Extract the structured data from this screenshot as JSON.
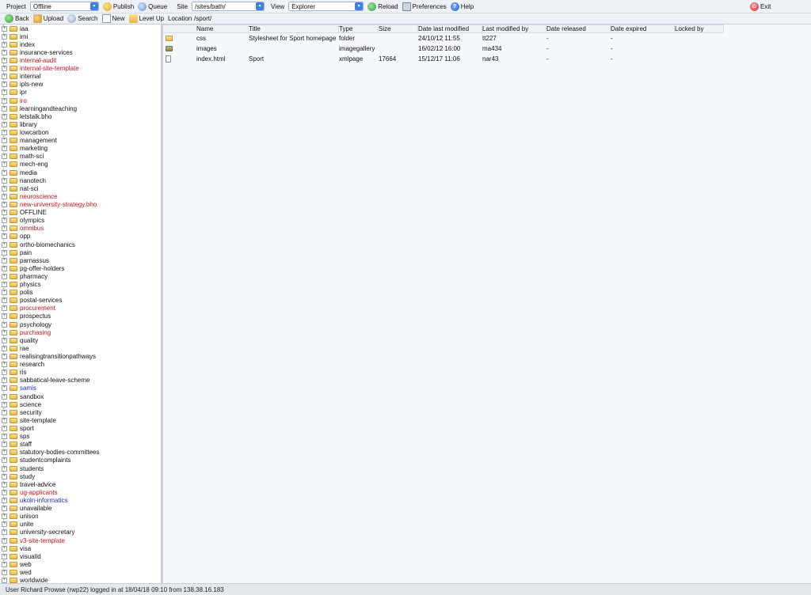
{
  "toolbar": {
    "project_label": "Project",
    "project_value": "Offline",
    "publish": "Publish",
    "queue": "Queue",
    "site_label": "Site",
    "site_value": "/sites/bath/",
    "view_label": "View",
    "view_value": "Explorer",
    "reload": "Reload",
    "preferences": "Preferences",
    "help": "Help",
    "exit": "Exit"
  },
  "toolbar2": {
    "back": "Back",
    "upload": "Upload",
    "search": "Search",
    "new": "New",
    "level_up": "Level Up",
    "location_label": "Location",
    "location_value": "/sport/"
  },
  "tree": [
    {
      "label": "iaa",
      "color": "black"
    },
    {
      "label": "imi",
      "color": "black"
    },
    {
      "label": "index",
      "color": "black"
    },
    {
      "label": "insurance-services",
      "color": "black"
    },
    {
      "label": "internal-audit",
      "color": "red"
    },
    {
      "label": "internal-site-template",
      "color": "red"
    },
    {
      "label": "internal",
      "color": "black"
    },
    {
      "label": "ipls-new",
      "color": "black"
    },
    {
      "label": "ipr",
      "color": "black"
    },
    {
      "label": "iro",
      "color": "red"
    },
    {
      "label": "learningandteaching",
      "color": "black"
    },
    {
      "label": "letstalk.bho",
      "color": "black"
    },
    {
      "label": "library",
      "color": "black"
    },
    {
      "label": "lowcarbon",
      "color": "black"
    },
    {
      "label": "management",
      "color": "black"
    },
    {
      "label": "marketing",
      "color": "black"
    },
    {
      "label": "math-sci",
      "color": "black"
    },
    {
      "label": "mech-eng",
      "color": "black"
    },
    {
      "label": "media",
      "color": "black"
    },
    {
      "label": "nanotech",
      "color": "black"
    },
    {
      "label": "nat-sci",
      "color": "black"
    },
    {
      "label": "neuroscience",
      "color": "red"
    },
    {
      "label": "new-university-strategy.bho",
      "color": "red"
    },
    {
      "label": "OFFLINE",
      "color": "black"
    },
    {
      "label": "olympics",
      "color": "black"
    },
    {
      "label": "omnibus",
      "color": "red"
    },
    {
      "label": "opp",
      "color": "black"
    },
    {
      "label": "ortho-biomechanics",
      "color": "black"
    },
    {
      "label": "pain",
      "color": "black"
    },
    {
      "label": "parnassus",
      "color": "black"
    },
    {
      "label": "pg-offer-holders",
      "color": "black"
    },
    {
      "label": "pharmacy",
      "color": "black"
    },
    {
      "label": "physics",
      "color": "black"
    },
    {
      "label": "polis",
      "color": "black"
    },
    {
      "label": "postal-services",
      "color": "black"
    },
    {
      "label": "procurement",
      "color": "red"
    },
    {
      "label": "prospectus",
      "color": "black"
    },
    {
      "label": "psychology",
      "color": "black"
    },
    {
      "label": "purchasing",
      "color": "red"
    },
    {
      "label": "quality",
      "color": "black"
    },
    {
      "label": "rae",
      "color": "black"
    },
    {
      "label": "realisingtransitionpathways",
      "color": "black"
    },
    {
      "label": "research",
      "color": "black"
    },
    {
      "label": "ris",
      "color": "black"
    },
    {
      "label": "sabbatical-leave-scheme",
      "color": "black"
    },
    {
      "label": "samis",
      "color": "blue"
    },
    {
      "label": "sandbox",
      "color": "black"
    },
    {
      "label": "science",
      "color": "black"
    },
    {
      "label": "security",
      "color": "black"
    },
    {
      "label": "site-template",
      "color": "black"
    },
    {
      "label": "sport",
      "color": "black"
    },
    {
      "label": "sps",
      "color": "black"
    },
    {
      "label": "staff",
      "color": "black"
    },
    {
      "label": "statutory-bodies-committees",
      "color": "black"
    },
    {
      "label": "studentcomplaints",
      "color": "black"
    },
    {
      "label": "students",
      "color": "black"
    },
    {
      "label": "study",
      "color": "black"
    },
    {
      "label": "travel-advice",
      "color": "black"
    },
    {
      "label": "ug-applicants",
      "color": "red"
    },
    {
      "label": "ukoln-informatics",
      "color": "blue"
    },
    {
      "label": "unavailable",
      "color": "black"
    },
    {
      "label": "unison",
      "color": "black"
    },
    {
      "label": "unite",
      "color": "black"
    },
    {
      "label": "university-secretary",
      "color": "black"
    },
    {
      "label": "v3-site-template",
      "color": "red"
    },
    {
      "label": "visa",
      "color": "black"
    },
    {
      "label": "visualid",
      "color": "black"
    },
    {
      "label": "web",
      "color": "black"
    },
    {
      "label": "wed",
      "color": "black"
    },
    {
      "label": "worldwide",
      "color": "black"
    }
  ],
  "columns": [
    "Name",
    "Title",
    "Type",
    "Size",
    "Date last modified",
    "Last modified by",
    "Date released",
    "Date expired",
    "Locked by"
  ],
  "files": [
    {
      "icon": "folder-icon",
      "name": "css",
      "title": "Stylesheet for Sport homepage",
      "type": "folder",
      "size": "",
      "modified": "24/10/12 11:55",
      "modified_by": "tt227",
      "released": "-",
      "expired": "-",
      "locked_by": ""
    },
    {
      "icon": "gallery-icon",
      "name": "images",
      "title": "",
      "type": "imagegallery",
      "size": "",
      "modified": "16/02/12 16:00",
      "modified_by": "ma434",
      "released": "-",
      "expired": "-",
      "locked_by": ""
    },
    {
      "icon": "page-icon",
      "name": "index.html",
      "title": "Sport",
      "type": "xmlpage",
      "size": "17664",
      "modified": "15/12/17 11:06",
      "modified_by": "nar43",
      "released": "-",
      "expired": "-",
      "locked_by": ""
    }
  ],
  "status": "User Richard Prowse (rwp22) logged in at 18/04/18 09:10 from 138.38.16.183",
  "colors": {
    "red": "#c4161c",
    "blue": "#1f2fb8",
    "black": "#111111"
  }
}
